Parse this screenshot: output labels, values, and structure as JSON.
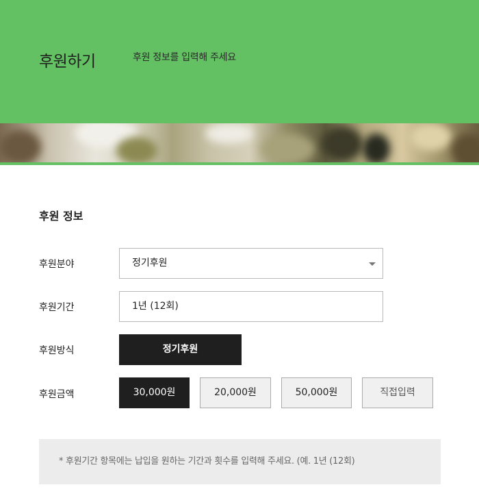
{
  "header": {
    "title": "후원하기",
    "subtitle": "후원 정보를 입력해 주세요"
  },
  "colors": {
    "brand_green": "#63c063",
    "dark_button": "#1f1f1f",
    "light_button": "#f0f0f0",
    "note_background": "#ececec"
  },
  "form": {
    "section_title": "후원 정보",
    "field_label": "후원분야",
    "field_value": "정기후원",
    "period_label": "후원기간",
    "period_value": "1년 (12회)",
    "method_label": "후원방식",
    "method_value": "정기후원",
    "amount_label": "후원금액",
    "amounts": [
      {
        "label": "30,000원",
        "selected": true
      },
      {
        "label": "20,000원",
        "selected": false
      },
      {
        "label": "50,000원",
        "selected": false
      },
      {
        "label": "직접입력",
        "selected": false
      }
    ]
  },
  "note": "* 후원기간 항목에는 납입을 원하는 기간과 횟수를 입력해 주세요. (예. 1년 (12회)",
  "icons": {
    "select_arrow": "chevron-down-icon"
  }
}
